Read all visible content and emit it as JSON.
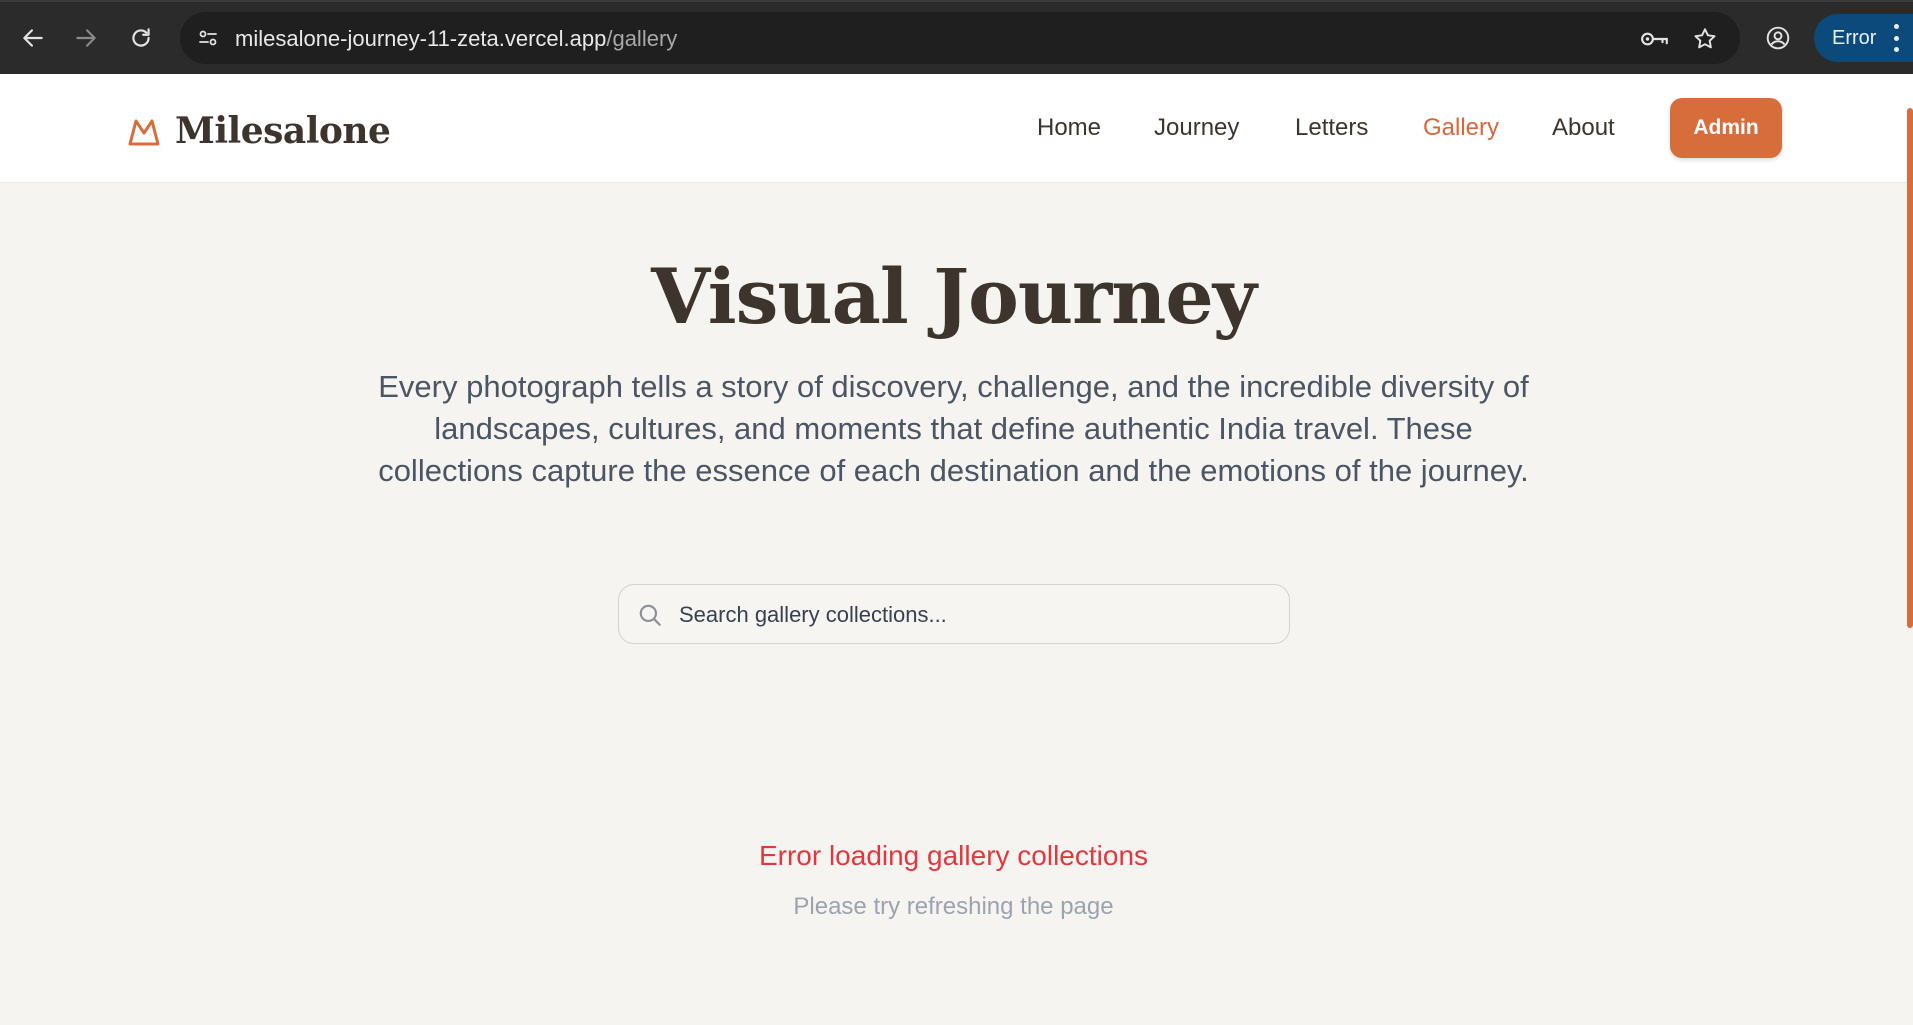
{
  "browser": {
    "url_domain": "milesalone-journey-11-zeta.vercel.app",
    "url_path": "/gallery",
    "profile_status": "Error",
    "icons": [
      "back-arrow-icon",
      "forward-arrow-icon",
      "reload-icon",
      "site-info-icon",
      "password-key-icon",
      "bookmark-star-icon",
      "profile-icon",
      "more-vert-icon"
    ]
  },
  "site": {
    "brand": "Milesalone",
    "nav": [
      {
        "label": "Home",
        "active": false
      },
      {
        "label": "Journey",
        "active": false
      },
      {
        "label": "Letters",
        "active": false
      },
      {
        "label": "Gallery",
        "active": true
      },
      {
        "label": "About",
        "active": false
      }
    ],
    "admin_label": "Admin",
    "accent_color": "#d86d3c"
  },
  "hero": {
    "title": "Visual Journey",
    "description": "Every photograph tells a story of discovery, challenge, and the incredible diversity of landscapes, cultures, and moments that define authentic India travel. These collections capture the essence of each destination and the emotions of the journey."
  },
  "search": {
    "placeholder": "Search gallery collections...",
    "value": ""
  },
  "error": {
    "title": "Error loading gallery collections",
    "subtitle": "Please try refreshing the page",
    "color": "#e0383e"
  }
}
